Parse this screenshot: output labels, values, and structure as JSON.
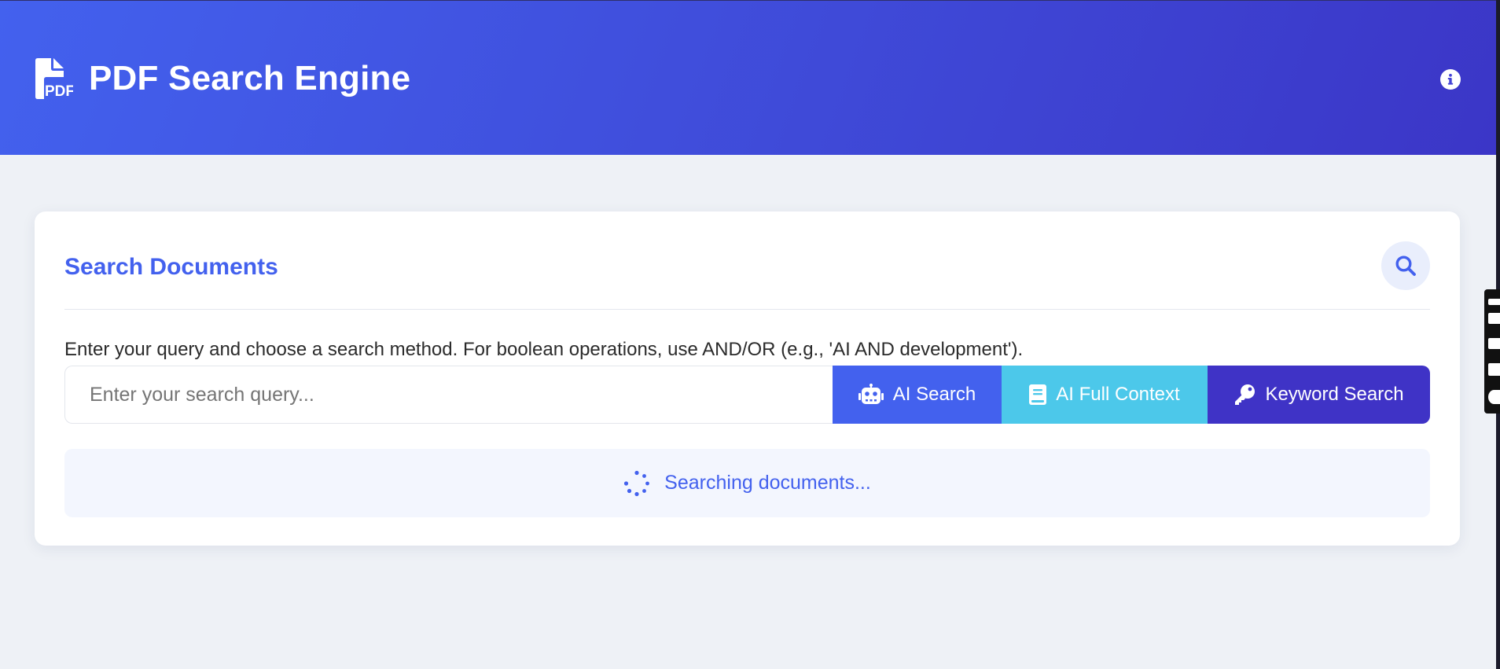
{
  "header": {
    "title": "PDF Search Engine",
    "logo_text": "PDF",
    "info_icon": "info-circle-icon"
  },
  "search_card": {
    "title": "Search Documents",
    "title_icon": "search-icon",
    "instructions": "Enter your query and choose a search method. For boolean operations, use AND/OR (e.g., 'AI AND development').",
    "input": {
      "placeholder": "Enter your search query...",
      "value": ""
    },
    "buttons": {
      "ai_search": {
        "label": "AI Search",
        "icon": "robot-icon"
      },
      "ai_full_context": {
        "label": "AI Full Context",
        "icon": "book-icon"
      },
      "keyword_search": {
        "label": "Keyword Search",
        "icon": "key-icon"
      }
    },
    "status": {
      "text": "Searching documents...",
      "icon": "spinner-icon"
    }
  },
  "colors": {
    "primary": "#4361ee",
    "accent_cyan": "#4cc8ea",
    "accent_indigo": "#3f33c6",
    "background": "#eef1f6"
  }
}
